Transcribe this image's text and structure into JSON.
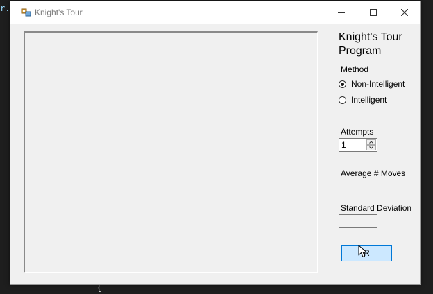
{
  "background": {
    "code_snippet": "r.B",
    "brace": "{"
  },
  "window": {
    "title": "Knight's Tour",
    "icon": "app-form-icon",
    "controls": {
      "minimize": "minimize-icon",
      "maximize": "maximize-icon",
      "close": "close-icon"
    }
  },
  "panel": {
    "heading": "Knight's Tour Program",
    "method": {
      "label": "Method",
      "options": [
        {
          "label": "Non-Intelligent",
          "checked": true
        },
        {
          "label": "Intelligent",
          "checked": false
        }
      ]
    },
    "attempts": {
      "label": "Attempts",
      "value": "1"
    },
    "average_moves": {
      "label": "Average # Moves",
      "value": ""
    },
    "std_dev": {
      "label": "Standard Deviation",
      "value": ""
    },
    "run_button": {
      "label": "R"
    }
  },
  "colors": {
    "window_bg": "#f0f0f0",
    "button_hover_bg": "#cce8ff",
    "button_hover_border": "#0078d7",
    "ide_bg": "#1e1e1e"
  }
}
